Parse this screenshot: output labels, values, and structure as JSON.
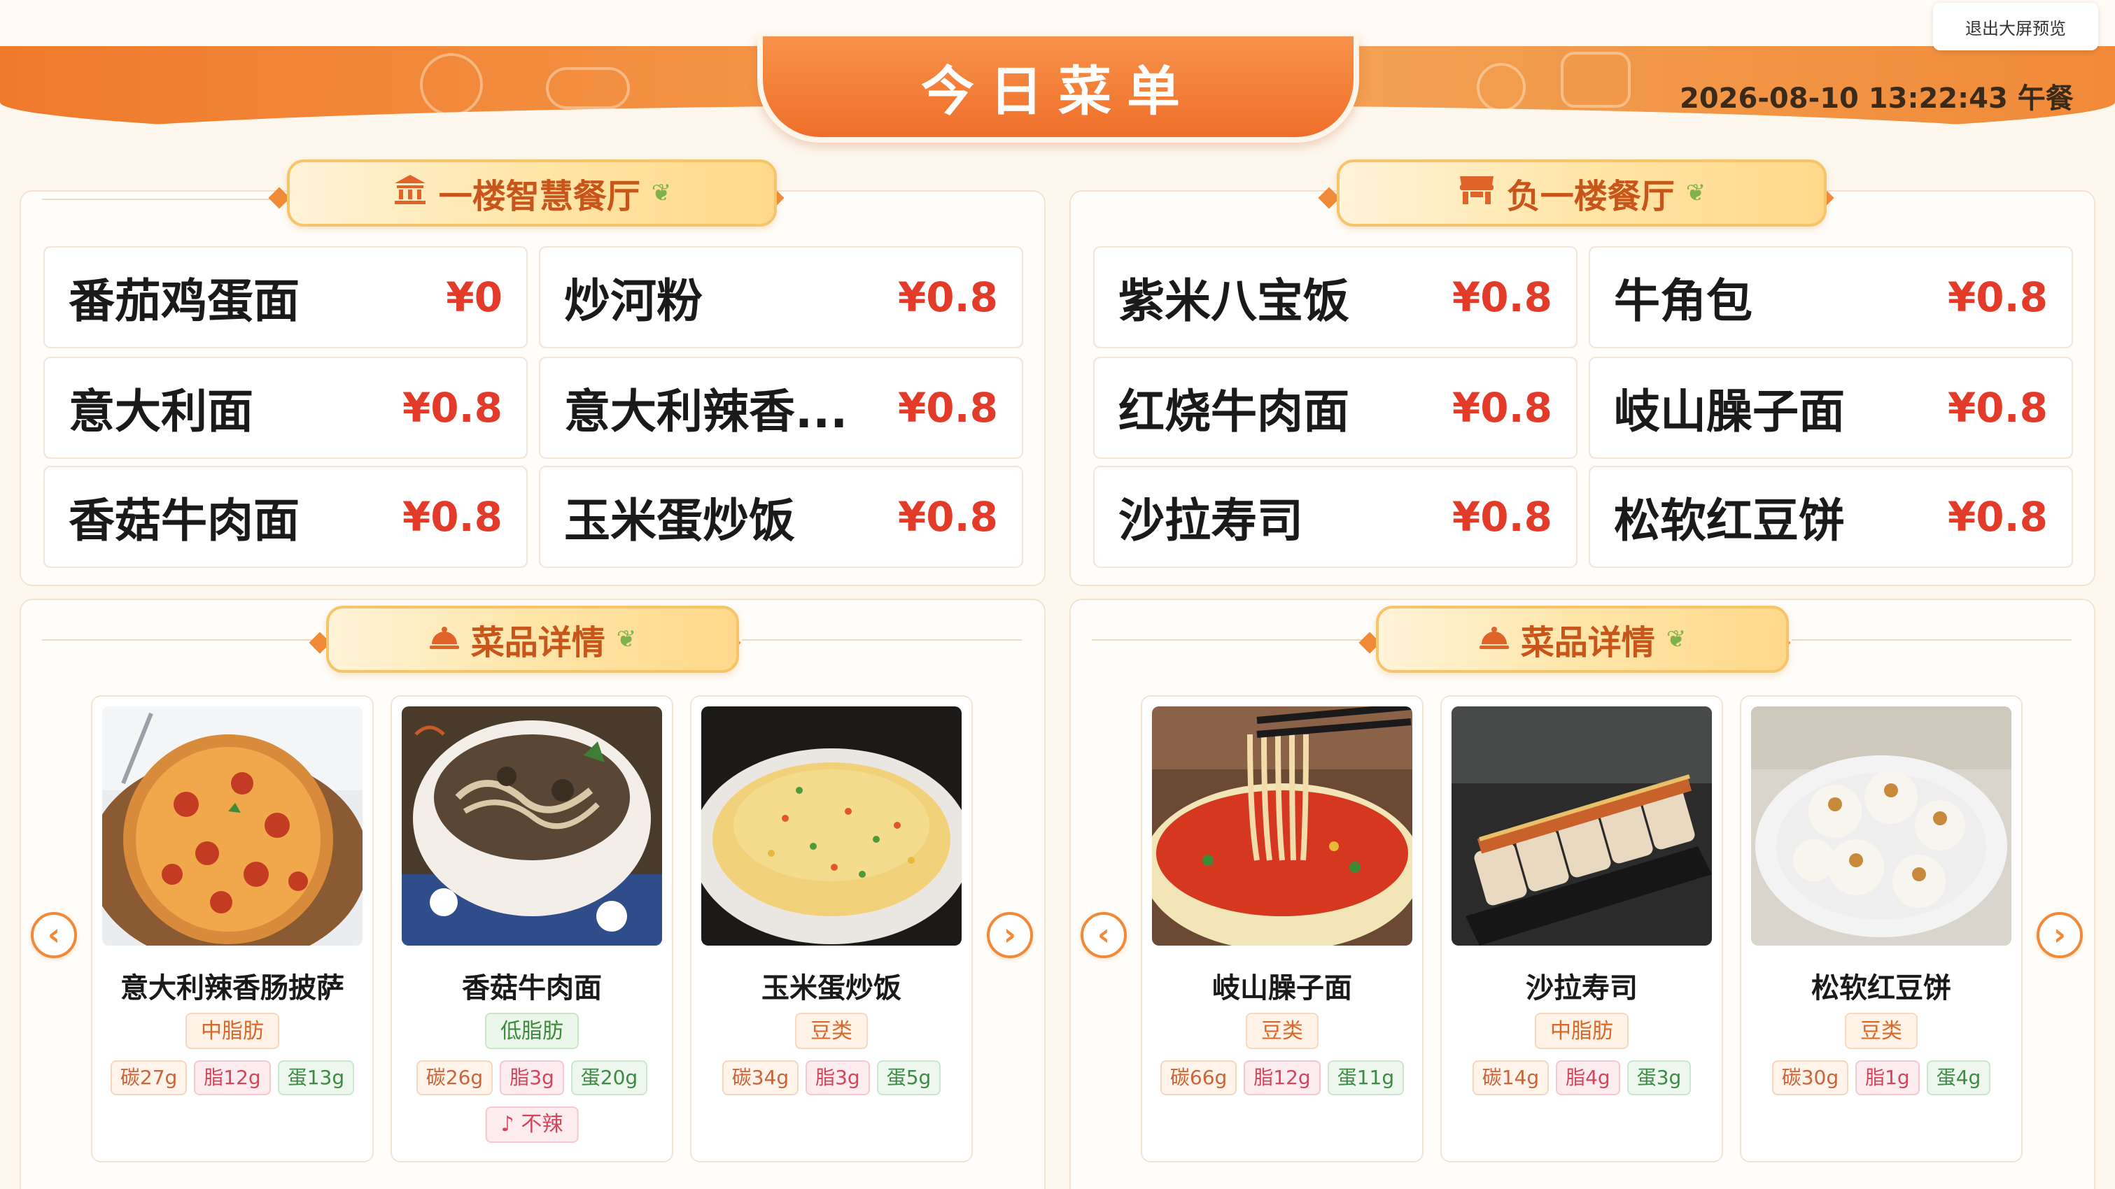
{
  "header": {
    "title": "今日菜单",
    "exit_label": "退出大屏预览",
    "datetime": "2026-08-10 13:22:43 午餐"
  },
  "colors": {
    "accent": "#f08a38",
    "price": "#e23b2a",
    "pill_text": "#c8561a"
  },
  "restaurants": [
    {
      "name": "一楼智慧餐厅",
      "icon": "building-icon",
      "menu": [
        {
          "dish": "番茄鸡蛋面",
          "price": "¥0"
        },
        {
          "dish": "炒河粉",
          "price": "¥0.8"
        },
        {
          "dish": "意大利面",
          "price": "¥0.8"
        },
        {
          "dish": "意大利辣香...",
          "price": "¥0.8"
        },
        {
          "dish": "香菇牛肉面",
          "price": "¥0.8"
        },
        {
          "dish": "玉米蛋炒饭",
          "price": "¥0.8"
        }
      ],
      "details_title": "菜品详情",
      "cards": [
        {
          "name": "意大利辣香肠披萨",
          "fat": "中脂肪",
          "carb": "碳27g",
          "fat_g": "脂12g",
          "protein": "蛋13g",
          "image": "pizza"
        },
        {
          "name": "香菇牛肉面",
          "fat": "低脂肪",
          "carb": "碳26g",
          "fat_g": "脂3g",
          "protein": "蛋20g",
          "spicy": "不辣",
          "image": "noodle-soup"
        },
        {
          "name": "玉米蛋炒饭",
          "fat": "豆类",
          "carb": "碳34g",
          "fat_g": "脂3g",
          "protein": "蛋5g",
          "image": "fried-rice"
        }
      ]
    },
    {
      "name": "负一楼餐厅",
      "icon": "storefront-icon",
      "menu": [
        {
          "dish": "紫米八宝饭",
          "price": "¥0.8"
        },
        {
          "dish": "牛角包",
          "price": "¥0.8"
        },
        {
          "dish": "红烧牛肉面",
          "price": "¥0.8"
        },
        {
          "dish": "岐山臊子面",
          "price": "¥0.8"
        },
        {
          "dish": "沙拉寿司",
          "price": "¥0.8"
        },
        {
          "dish": "松软红豆饼",
          "price": "¥0.8"
        }
      ],
      "details_title": "菜品详情",
      "cards": [
        {
          "name": "岐山臊子面",
          "fat": "豆类",
          "carb": "碳66g",
          "fat_g": "脂12g",
          "protein": "蛋11g",
          "image": "red-noodles"
        },
        {
          "name": "沙拉寿司",
          "fat": "中脂肪",
          "carb": "碳14g",
          "fat_g": "脂4g",
          "protein": "蛋3g",
          "image": "sushi"
        },
        {
          "name": "松软红豆饼",
          "fat": "豆类",
          "carb": "碳30g",
          "fat_g": "脂1g",
          "protein": "蛋4g",
          "image": "buns"
        }
      ]
    }
  ]
}
